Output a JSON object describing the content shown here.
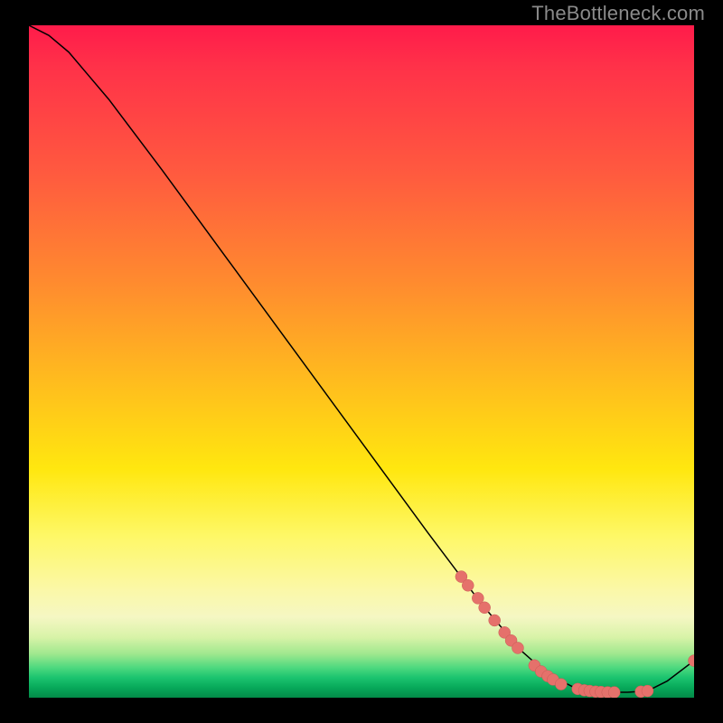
{
  "watermark": "TheBottleneck.com",
  "colors": {
    "curve_stroke": "#000000",
    "marker_fill": "#e5716b",
    "marker_stroke": "#c95a55"
  },
  "chart_data": {
    "type": "line",
    "title": "",
    "xlabel": "",
    "ylabel": "",
    "xlim": [
      0,
      100
    ],
    "ylim": [
      0,
      100
    ],
    "curve": [
      {
        "x": 0.0,
        "y": 100.0
      },
      {
        "x": 3.0,
        "y": 98.5
      },
      {
        "x": 6.0,
        "y": 96.0
      },
      {
        "x": 9.0,
        "y": 92.5
      },
      {
        "x": 12.0,
        "y": 89.0
      },
      {
        "x": 20.0,
        "y": 78.5
      },
      {
        "x": 30.0,
        "y": 65.0
      },
      {
        "x": 40.0,
        "y": 51.5
      },
      {
        "x": 50.0,
        "y": 38.0
      },
      {
        "x": 60.0,
        "y": 24.5
      },
      {
        "x": 68.0,
        "y": 14.0
      },
      {
        "x": 74.0,
        "y": 7.0
      },
      {
        "x": 78.0,
        "y": 3.5
      },
      {
        "x": 82.0,
        "y": 1.5
      },
      {
        "x": 86.0,
        "y": 0.8
      },
      {
        "x": 90.0,
        "y": 0.8
      },
      {
        "x": 93.0,
        "y": 1.0
      },
      {
        "x": 96.0,
        "y": 2.5
      },
      {
        "x": 100.0,
        "y": 5.5
      }
    ],
    "series": [
      {
        "name": "markers",
        "points": [
          {
            "x": 65.0,
            "y": 18.0
          },
          {
            "x": 66.0,
            "y": 16.7
          },
          {
            "x": 67.5,
            "y": 14.8
          },
          {
            "x": 68.5,
            "y": 13.4
          },
          {
            "x": 70.0,
            "y": 11.5
          },
          {
            "x": 71.5,
            "y": 9.7
          },
          {
            "x": 72.5,
            "y": 8.5
          },
          {
            "x": 73.5,
            "y": 7.4
          },
          {
            "x": 76.0,
            "y": 4.8
          },
          {
            "x": 77.0,
            "y": 3.9
          },
          {
            "x": 78.0,
            "y": 3.2
          },
          {
            "x": 78.8,
            "y": 2.7
          },
          {
            "x": 80.0,
            "y": 2.0
          },
          {
            "x": 82.5,
            "y": 1.3
          },
          {
            "x": 83.5,
            "y": 1.1
          },
          {
            "x": 84.3,
            "y": 1.0
          },
          {
            "x": 85.2,
            "y": 0.9
          },
          {
            "x": 86.0,
            "y": 0.85
          },
          {
            "x": 87.0,
            "y": 0.8
          },
          {
            "x": 88.0,
            "y": 0.8
          },
          {
            "x": 92.0,
            "y": 0.9
          },
          {
            "x": 93.0,
            "y": 1.0
          },
          {
            "x": 100.0,
            "y": 5.5
          }
        ]
      }
    ]
  }
}
